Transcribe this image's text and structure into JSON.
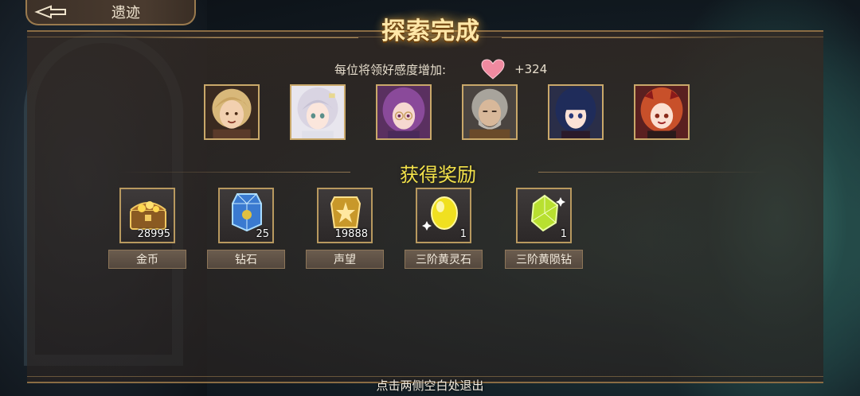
{
  "header": {
    "back_label": "遗迹"
  },
  "dialog": {
    "title": "探索完成",
    "favor_label": "每位将领好感度增加:",
    "favor_value": "+324",
    "reward_title": "获得奖励",
    "exit_hint": "点击两侧空白处退出"
  },
  "characters": [
    {
      "name": "blonde-hero",
      "hair": "#d8b87a"
    },
    {
      "name": "silver-haired-girl",
      "hair": "#d9d4e2"
    },
    {
      "name": "purple-haired-girl",
      "hair": "#8a4a9a"
    },
    {
      "name": "grey-bearded-man",
      "hair": "#a8a49c"
    },
    {
      "name": "dark-blue-haired-girl",
      "hair": "#1f2c5a"
    },
    {
      "name": "orange-haired-girl",
      "hair": "#c8502a"
    }
  ],
  "rewards": [
    {
      "label": "金币",
      "count": "28995",
      "icon": "treasure-chest-icon"
    },
    {
      "label": "钻石",
      "count": "25",
      "icon": "diamond-crystal-icon"
    },
    {
      "label": "声望",
      "count": "19888",
      "icon": "prestige-badge-icon"
    },
    {
      "label": "三阶黄灵石",
      "count": "1",
      "icon": "yellow-spirit-stone-icon"
    },
    {
      "label": "三阶黄陨钻",
      "count": "1",
      "icon": "yellow-meteor-diamond-icon"
    }
  ],
  "colors": {
    "accent_gold": "#c9a86a",
    "reward_title": "#f3e24a",
    "heart": "#f08aa0"
  }
}
